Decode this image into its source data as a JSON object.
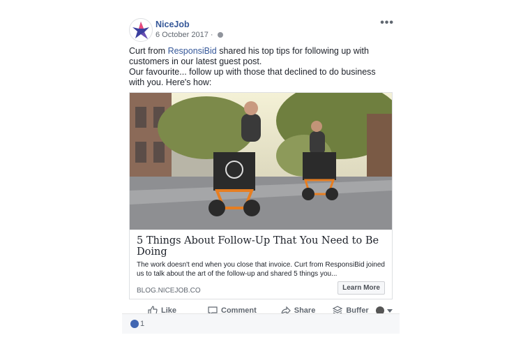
{
  "post": {
    "page_name": "NiceJob",
    "date": "6 October 2017 ·",
    "more": "•••",
    "text": {
      "prefix": "Curt from ",
      "mention": "ResponsiBid",
      "suffix": " shared his top tips for following up with customers in our latest guest post.",
      "line2": "Our favourite... follow up with those that declined to do business with you. Here's how:"
    }
  },
  "link_preview": {
    "headline": "5 Things About Follow-Up That You Need to Be Doing",
    "description": "The work doesn't end when you close that invoice. Curt from ResponsiBid joined us to talk about the art of the follow-up and shared 5 things you...",
    "domain": "BLOG.NICEJOB.CO",
    "button": "Learn More"
  },
  "actions": {
    "like": "Like",
    "comment": "Comment",
    "share": "Share",
    "buffer": "Buffer"
  },
  "reactions": {
    "count": "1"
  },
  "colors": {
    "link": "#365899",
    "accent": "#4267b2"
  }
}
